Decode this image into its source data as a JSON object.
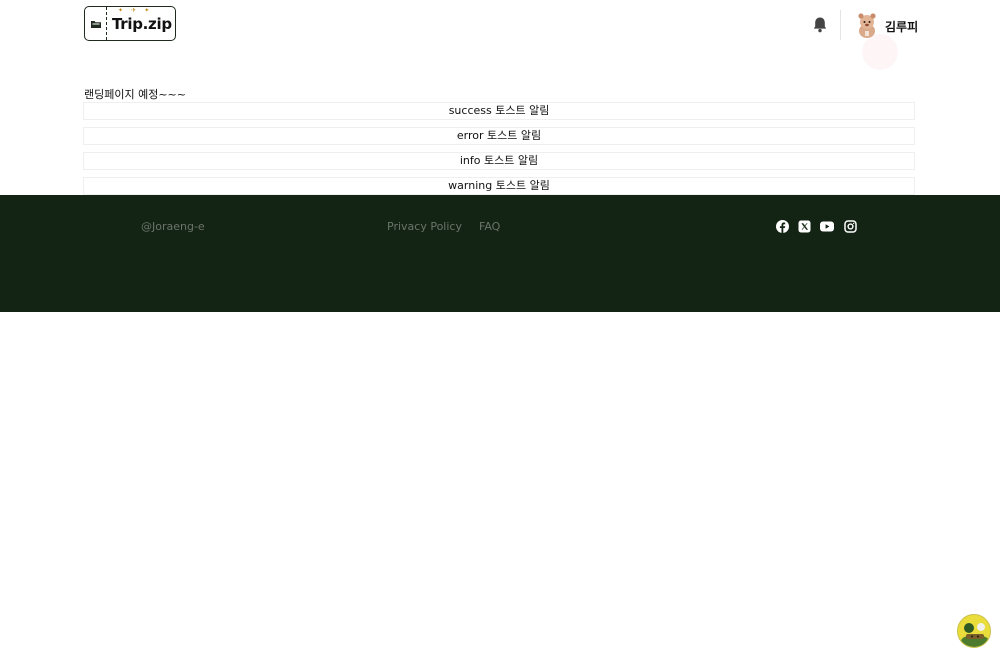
{
  "header": {
    "logo_text": "Trip.zip",
    "user_name": "김루피"
  },
  "main": {
    "landing_text": "랜딩페이지 예정~~~",
    "toast_buttons": [
      {
        "label": "success 토스트 알림"
      },
      {
        "label": "error 토스트 알림"
      },
      {
        "label": "info 토스트 알림"
      },
      {
        "label": "warning 토스트 알림"
      }
    ]
  },
  "footer": {
    "copyright": "@Joraeng-e",
    "links": [
      {
        "label": "Privacy Policy"
      },
      {
        "label": "FAQ"
      }
    ],
    "social_icons": [
      "facebook-icon",
      "x-icon",
      "youtube-icon",
      "instagram-icon"
    ]
  },
  "colors": {
    "footer_bg": "#142414",
    "footer_text": "#6a746a",
    "accent_yellow": "#e9dc3b"
  }
}
